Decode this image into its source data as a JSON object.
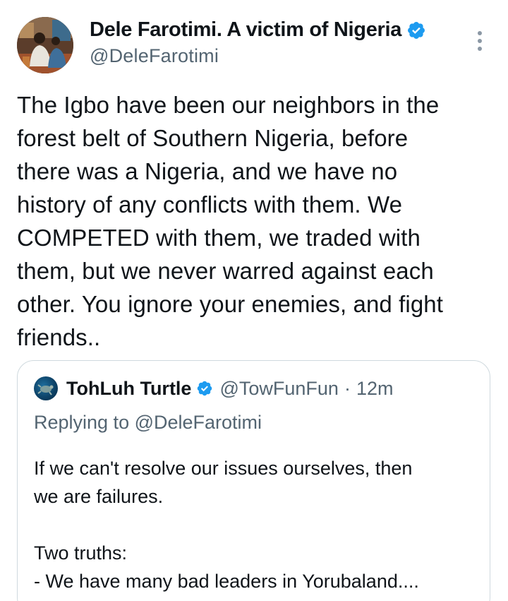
{
  "tweet": {
    "author": {
      "display_name": "Dele Farotimi. A victim of Nigeria",
      "handle": "@DeleFarotimi",
      "verified": true,
      "avatar_icon": "profile-photo"
    },
    "text": "The Igbo have been our neighbors in the\nforest belt of Southern Nigeria, before\nthere was a Nigeria, and we have no\nhistory of any conflicts with them. We\nCOMPETED with them, we traded with\nthem, but we never warred against each\nother. You ignore your enemies, and fight\nfriends..",
    "more_icon": "more-vertical-icon"
  },
  "quoted_tweet": {
    "author": {
      "display_name": "TohLuh Turtle",
      "handle": "@TowFunFun",
      "verified": true
    },
    "separator": "·",
    "time": "12m",
    "replying_to": "Replying to @DeleFarotimi",
    "text": "If we can't resolve our issues ourselves, then\nwe are failures.\n\nTwo truths:\n- We have many bad leaders in Yorubaland...."
  },
  "colors": {
    "text_primary": "#0f1419",
    "text_secondary": "#536471",
    "verified_blue": "#1d9bf0",
    "border": "#cfd9de"
  }
}
